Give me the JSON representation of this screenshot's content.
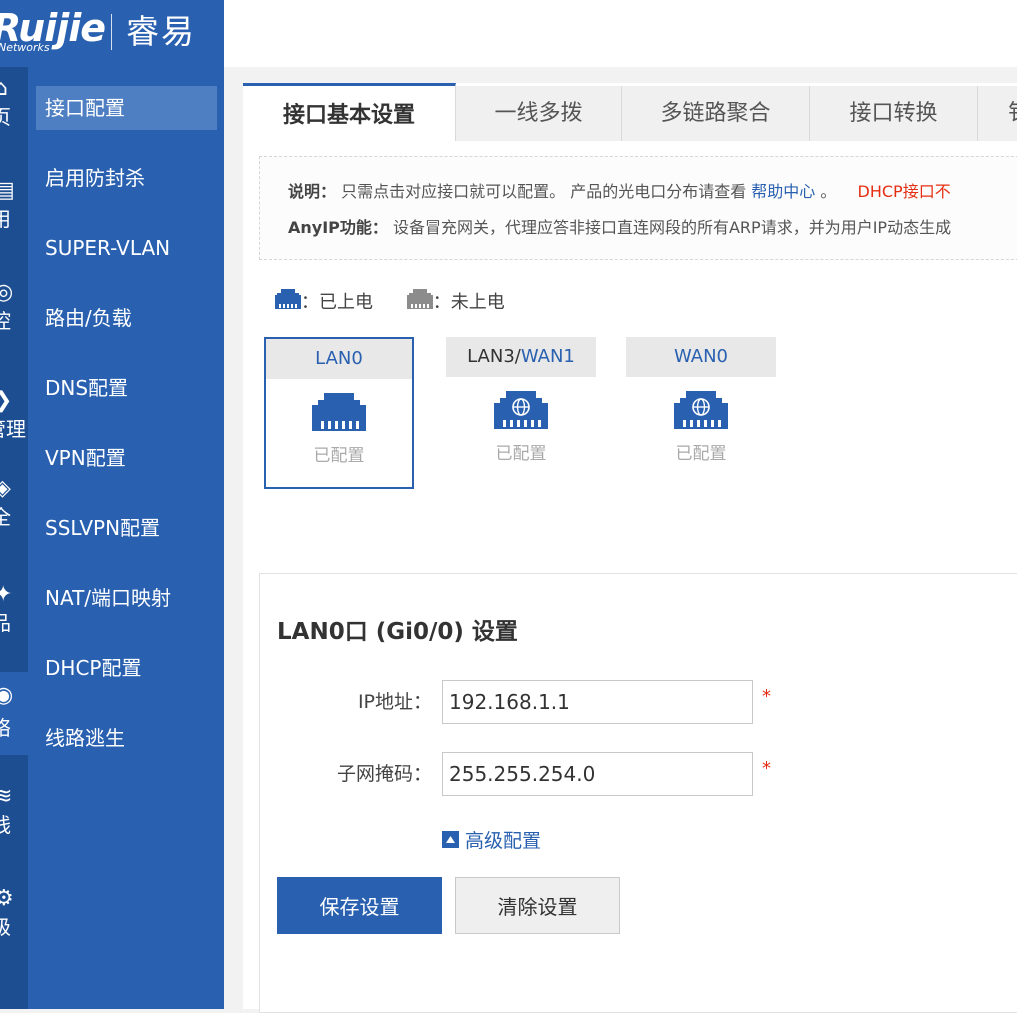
{
  "brand": {
    "logo": "Ruijie",
    "subline": "Networks",
    "product": "睿易"
  },
  "rail": {
    "items": [
      {
        "icon": "home-icon",
        "glyph": "⌂",
        "label": "页"
      },
      {
        "icon": "apps-icon",
        "glyph": "▤",
        "label": "用"
      },
      {
        "icon": "monitor-icon",
        "glyph": "◎",
        "label": "控"
      },
      {
        "icon": "manage-icon",
        "glyph": "❯",
        "label": "管理"
      },
      {
        "icon": "security-icon",
        "glyph": "◈",
        "label": "全"
      },
      {
        "icon": "advanced-icon",
        "glyph": "✦",
        "label": "品"
      },
      {
        "icon": "network-icon",
        "glyph": "◉",
        "label": "络"
      },
      {
        "icon": "wireless-icon",
        "glyph": "≋",
        "label": "线"
      },
      {
        "icon": "system-icon",
        "glyph": "⚙",
        "label": "级"
      }
    ]
  },
  "menu": {
    "items": [
      {
        "label": "接口配置"
      },
      {
        "label": "启用防封杀"
      },
      {
        "label": "SUPER-VLAN"
      },
      {
        "label": "路由/负载"
      },
      {
        "label": "DNS配置"
      },
      {
        "label": "VPN配置"
      },
      {
        "label": "SSLVPN配置"
      },
      {
        "label": "NAT/端口映射"
      },
      {
        "label": "DHCP配置"
      },
      {
        "label": "线路逃生"
      }
    ],
    "active_index": 0
  },
  "tabs": [
    {
      "label": "接口基本设置"
    },
    {
      "label": "一线多拨"
    },
    {
      "label": "多链路聚合"
    },
    {
      "label": "接口转换"
    },
    {
      "label": "钅"
    }
  ],
  "notes": {
    "line1": {
      "title": "说明：",
      "text": "只需点击对应接口就可以配置。 产品的光电口分布请查看",
      "link": "帮助中心",
      "after": "。",
      "red": "DHCP接口不"
    },
    "line2": {
      "title": "AnyIP功能：",
      "text": "设备冒充网关，代理应答非接口直连网段的所有ARP请求，并为用户IP动态生成"
    }
  },
  "legend": {
    "powered": "：已上电",
    "unpowered": "：未上电"
  },
  "colors": {
    "accent": "#2961b0",
    "sidebar": "#2961b0",
    "rail": "#1e4e92",
    "required": "#e62e12",
    "unpowered": "#8c8c8c"
  },
  "ports": [
    {
      "prefix": "",
      "name": "LAN0",
      "status": "已配置",
      "icon": "ethernet-port-icon"
    },
    {
      "prefix": "LAN3/",
      "name": "WAN1",
      "status": "已配置",
      "icon": "wan-port-icon"
    },
    {
      "prefix": "",
      "name": "WAN0",
      "status": "已配置",
      "icon": "wan-port-icon"
    }
  ],
  "settings": {
    "title": "LAN0口 (Gi0/0) 设置",
    "ip_label": "IP地址：",
    "ip_value": "192.168.1.1",
    "mask_label": "子网掩码：",
    "mask_value": "255.255.254.0",
    "required_mark": "*",
    "advanced": "高级配置",
    "save": "保存设置",
    "clear": "清除设置"
  }
}
